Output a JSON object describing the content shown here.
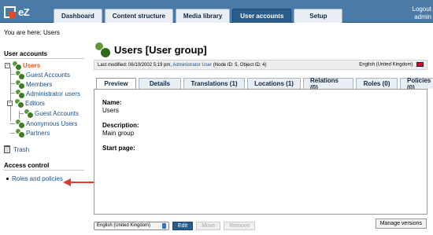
{
  "logo": {
    "text": "eZ"
  },
  "tabs": [
    {
      "label": "Dashboard"
    },
    {
      "label": "Content structure"
    },
    {
      "label": "Media library"
    },
    {
      "label": "User accounts"
    },
    {
      "label": "Setup"
    }
  ],
  "user_links": {
    "logout": "Logout",
    "user": "admin"
  },
  "breadcrumb": "You are here: Users",
  "left_menu": {
    "heading": "User accounts",
    "tree": [
      {
        "label": "Users"
      },
      {
        "label": "Guest Accounts"
      },
      {
        "label": "Members"
      },
      {
        "label": "Administrator users"
      },
      {
        "label": "Editors"
      },
      {
        "label": "Guest Accounts"
      },
      {
        "label": "Anonymous Users"
      },
      {
        "label": "Partners"
      }
    ],
    "trash": "Trash",
    "access_heading": "Access control",
    "roles_link": "Roles and policies"
  },
  "main": {
    "title": "Users [User group]",
    "info_prefix": "Last modified: 06/10/2002 5:19 pm,",
    "info_user": "Administrator User",
    "info_suffix": "(Node ID: 5, Object ID: 4)",
    "info_lang": "English (United Kingdom)",
    "content_tabs": [
      {
        "label": "Preview"
      },
      {
        "label": "Details"
      },
      {
        "label": "Translations (1)"
      },
      {
        "label": "Locations (1)"
      },
      {
        "label": "Relations (0)"
      },
      {
        "label": "Roles (0)"
      },
      {
        "label": "Policies (0)"
      }
    ],
    "fields": {
      "name_label": "Name:",
      "name_value": "Users",
      "desc_label": "Description:",
      "desc_value": "Main group",
      "start_label": "Start page:"
    }
  },
  "bottom": {
    "language": "English (United Kingdom)",
    "edit": "Edit",
    "move": "Move",
    "remove": "Remove",
    "manage_versions": "Manage versions"
  },
  "colors": {
    "header": "#4a7aa8",
    "active_tab": "#2b5d8c",
    "current_item": "#e8561c",
    "annotation_arrow": "#e03c2c"
  }
}
